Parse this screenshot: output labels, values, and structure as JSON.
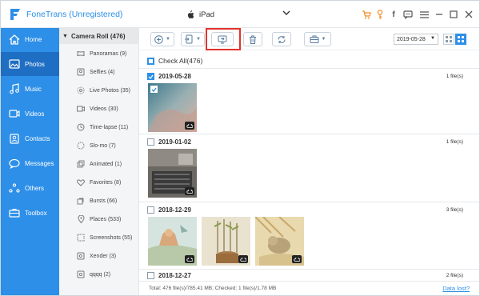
{
  "app": {
    "title": "FoneTrans (Unregistered)"
  },
  "device": {
    "name": "iPad"
  },
  "sidebar": {
    "items": [
      {
        "label": "Home",
        "icon": "home-icon",
        "active": false
      },
      {
        "label": "Photos",
        "icon": "photos-icon",
        "active": true
      },
      {
        "label": "Music",
        "icon": "music-icon",
        "active": false
      },
      {
        "label": "Videos",
        "icon": "videos-icon",
        "active": false
      },
      {
        "label": "Contacts",
        "icon": "contacts-icon",
        "active": false
      },
      {
        "label": "Messages",
        "icon": "messages-icon",
        "active": false
      },
      {
        "label": "Others",
        "icon": "others-icon",
        "active": false
      },
      {
        "label": "Toolbox",
        "icon": "toolbox-icon",
        "active": false
      }
    ]
  },
  "albums": {
    "header": "Camera Roll (476)",
    "items": [
      {
        "label": "Panoramas (9)",
        "icon": "panorama-icon"
      },
      {
        "label": "Selfies (4)",
        "icon": "selfie-icon"
      },
      {
        "label": "Live Photos (35)",
        "icon": "live-photo-icon"
      },
      {
        "label": "Videos (30)",
        "icon": "video-icon"
      },
      {
        "label": "Time-lapse (11)",
        "icon": "timelapse-icon"
      },
      {
        "label": "Slo-mo (7)",
        "icon": "slomo-icon"
      },
      {
        "label": "Animated (1)",
        "icon": "animated-icon"
      },
      {
        "label": "Favorites (8)",
        "icon": "heart-icon"
      },
      {
        "label": "Bursts (66)",
        "icon": "bursts-icon"
      },
      {
        "label": "Places (533)",
        "icon": "places-icon"
      },
      {
        "label": "Screenshots (55)",
        "icon": "screenshot-icon"
      },
      {
        "label": "Xender (3)",
        "icon": "folder-icon"
      },
      {
        "label": "qqqq (2)",
        "icon": "folder-icon"
      }
    ]
  },
  "toolbar": {
    "date_value": "2019-05-28"
  },
  "content": {
    "check_all": "Check All(476)",
    "groups": [
      {
        "date": "2019-05-28",
        "count": "1 file(s)",
        "checked": true
      },
      {
        "date": "2019-01-02",
        "count": "1 file(s)",
        "checked": false
      },
      {
        "date": "2018-12-29",
        "count": "3 file(s)",
        "checked": false
      },
      {
        "date": "2018-12-27",
        "count": "2 file(s)",
        "checked": false
      }
    ]
  },
  "status": {
    "text": "Total: 476 file(s)/785.41 MB; Checked: 1 file(s)/1.78 MB",
    "link": "Data lost?"
  },
  "colors": {
    "accent": "#2d8fe8",
    "highlight": "#e3332b"
  }
}
